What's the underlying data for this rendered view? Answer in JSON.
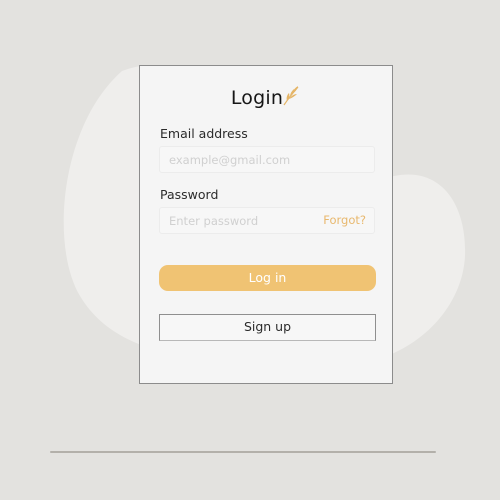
{
  "login_card": {
    "title": "Login",
    "email": {
      "label": "Email address",
      "placeholder": "example@gmail.com",
      "value": ""
    },
    "password": {
      "label": "Password",
      "placeholder": "Enter password",
      "value": "",
      "forgot_link": "Forgot?"
    },
    "login_button": "Log in",
    "signup_button": "Sign up"
  },
  "icons": {
    "logo": "wheat-leaf-icon"
  },
  "colors": {
    "background": "#e3e2df",
    "blob": "#efeeec",
    "card": "#f5f5f5",
    "accent": "#f0c373",
    "link": "#e8b86e",
    "title_text": "#161616"
  }
}
